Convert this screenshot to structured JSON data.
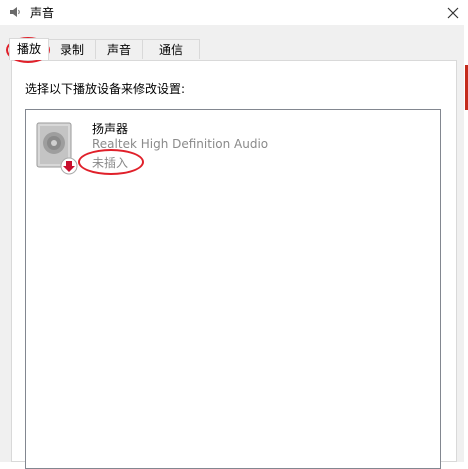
{
  "window": {
    "title": "声音",
    "icon": "speaker-icon",
    "close_icon": "close-icon"
  },
  "tabs": [
    {
      "label": "播放",
      "active": true
    },
    {
      "label": "录制",
      "active": false
    },
    {
      "label": "声音",
      "active": false
    },
    {
      "label": "通信",
      "active": false
    }
  ],
  "panel": {
    "instruction": "选择以下播放设备来修改设置:"
  },
  "devices": [
    {
      "name": "扬声器",
      "description": "Realtek High Definition Audio",
      "status": "未插入",
      "icon": "speaker-device-icon",
      "status_icon": "red-down-arrow-icon"
    }
  ],
  "colors": {
    "annotation": "#e0202a",
    "dialog_bg": "#f0f0f0",
    "status_text": "#8a8a8a",
    "status_arrow": "#c8102e"
  }
}
